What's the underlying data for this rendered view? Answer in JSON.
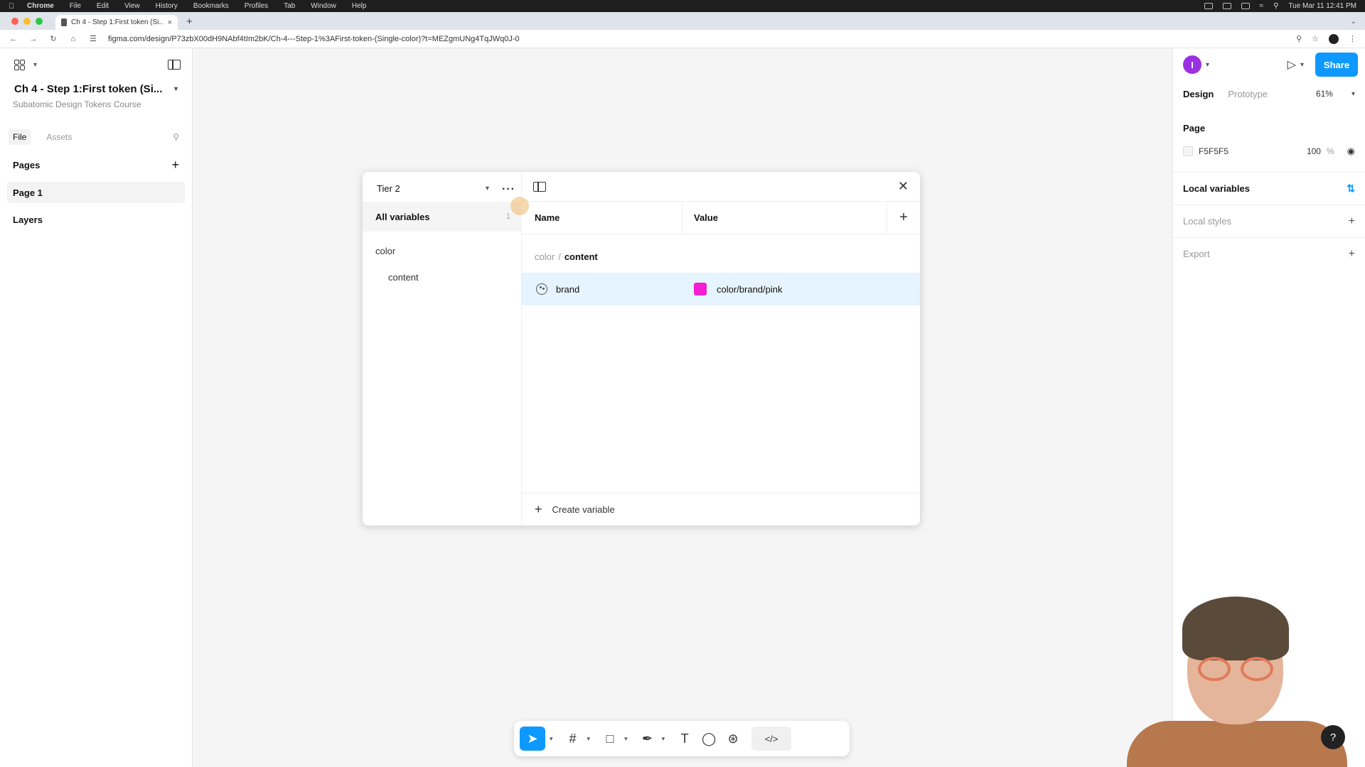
{
  "menubar": {
    "app": "Chrome",
    "items": [
      "File",
      "Edit",
      "View",
      "History",
      "Bookmarks",
      "Profiles",
      "Tab",
      "Window",
      "Help"
    ],
    "clock": "Tue Mar 11  12:41 PM"
  },
  "browser": {
    "tab_title": "Ch 4 - Step 1:First token (Si...",
    "url": "figma.com/design/P73zbX00dH9NAbf4tIm2bK/Ch-4---Step-1%3AFirst-token-(Single-color)?t=MEZgmUNg4TqJWq0J-0"
  },
  "left_panel": {
    "file_title": "Ch 4 - Step 1:First token (Si...",
    "file_subtitle": "Subatomic Design Tokens Course",
    "tab_file": "File",
    "tab_assets": "Assets",
    "pages_heading": "Pages",
    "page_item": "Page 1",
    "layers_heading": "Layers"
  },
  "right_panel": {
    "avatar_initial": "I",
    "share_label": "Share",
    "tab_design": "Design",
    "tab_prototype": "Prototype",
    "zoom": "61%",
    "page_heading": "Page",
    "page_color_hex": "F5F5F5",
    "page_color_opacity": "100",
    "page_color_unit": "%",
    "local_variables": "Local variables",
    "local_styles": "Local styles",
    "export": "Export"
  },
  "variables_dialog": {
    "collection": "Tier 2",
    "all_variables": "All variables",
    "all_variables_count": "1",
    "group": "color",
    "subgroup": "content",
    "col_name": "Name",
    "col_value": "Value",
    "crumb_parent": "color",
    "crumb_sep": "/",
    "crumb_current": "content",
    "variable_name": "brand",
    "variable_value": "color/brand/pink",
    "variable_color": "#F41ED2",
    "create_variable": "Create variable"
  },
  "icons": [
    "figma-menu-icon",
    "panel-toggle-icon",
    "search-icon",
    "plus-icon",
    "play-icon",
    "eye-icon",
    "adjust-icon",
    "more-icon",
    "sidebar-icon",
    "close-icon",
    "palette-icon",
    "move-icon",
    "frame-icon",
    "rectangle-icon",
    "pen-icon",
    "text-icon",
    "comment-icon",
    "actions-icon",
    "code-icon",
    "help-icon"
  ],
  "colors": {
    "accent": "#0d99ff",
    "avatar": "#9b30e3",
    "selected_row": "#e5f4ff"
  }
}
